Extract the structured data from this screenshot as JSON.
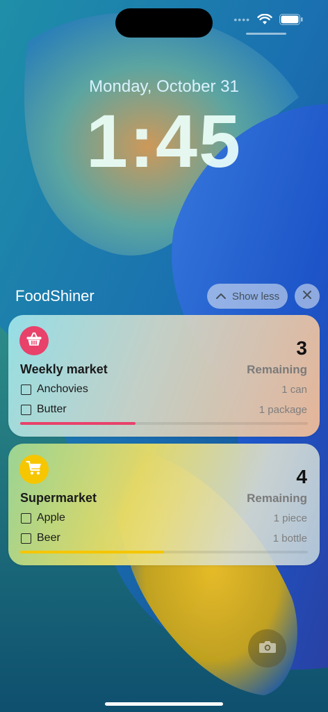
{
  "status_bar": {
    "signal_dots": "••••",
    "wifi_icon": "wifi-icon",
    "battery_icon": "battery-icon"
  },
  "lock": {
    "date": "Monday, October 31",
    "time": "1:45"
  },
  "group": {
    "app_name": "FoodShiner",
    "show_less_label": "Show less",
    "close_icon": "close-icon"
  },
  "lists": [
    {
      "title": "Weekly market",
      "count": "3",
      "remaining_label": "Remaining",
      "icon": "basket-icon",
      "accent": "#e8416a",
      "progress": 0.4,
      "items": [
        {
          "name": "Anchovies",
          "qty": "1 can"
        },
        {
          "name": "Butter",
          "qty": "1 package"
        }
      ]
    },
    {
      "title": "Supermarket",
      "count": "4",
      "remaining_label": "Remaining",
      "icon": "cart-icon",
      "accent": "#f6c600",
      "progress": 0.5,
      "items": [
        {
          "name": "Apple",
          "qty": "1 piece"
        },
        {
          "name": "Beer",
          "qty": "1 bottle"
        }
      ]
    }
  ],
  "camera_icon": "camera-icon"
}
